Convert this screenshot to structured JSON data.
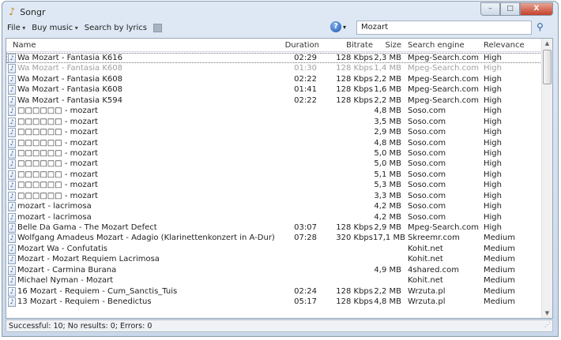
{
  "window": {
    "title": "Songr",
    "minimize": "–",
    "maximize": "□",
    "close": "X"
  },
  "toolbar": {
    "file": "File",
    "buy_music": "Buy music",
    "search_by_lyrics": "Search by lyrics"
  },
  "search": {
    "value": "Mozart"
  },
  "columns": {
    "name": "Name",
    "duration": "Duration",
    "bitrate": "Bitrate",
    "size": "Size",
    "engine": "Search engine",
    "relevance": "Relevance"
  },
  "rows": [
    {
      "name": "Wa Mozart - Fantasia K616",
      "duration": "02:29",
      "bitrate": "128 Kbps",
      "size": "2,3 MB",
      "engine": "Mpeg-Search.com",
      "relevance": "High",
      "state": "selected"
    },
    {
      "name": "Wa Mozart - Fantasia K608",
      "duration": "01:30",
      "bitrate": "128 Kbps",
      "size": "1,4 MB",
      "engine": "Mpeg-Search.com",
      "relevance": "High",
      "state": "dimmed"
    },
    {
      "name": "Wa Mozart - Fantasia K608",
      "duration": "02:22",
      "bitrate": "128 Kbps",
      "size": "2,2 MB",
      "engine": "Mpeg-Search.com",
      "relevance": "High"
    },
    {
      "name": "Wa Mozart - Fantasia K608",
      "duration": "01:41",
      "bitrate": "128 Kbps",
      "size": "1,6 MB",
      "engine": "Mpeg-Search.com",
      "relevance": "High"
    },
    {
      "name": "Wa Mozart - Fantasia K594",
      "duration": "02:22",
      "bitrate": "128 Kbps",
      "size": "2,2 MB",
      "engine": "Mpeg-Search.com",
      "relevance": "High"
    },
    {
      "name": "□□□□□□ - mozart",
      "duration": "",
      "bitrate": "",
      "size": "4,8 MB",
      "engine": "Soso.com",
      "relevance": "High"
    },
    {
      "name": "□□□□□□ - mozart",
      "duration": "",
      "bitrate": "",
      "size": "3,5 MB",
      "engine": "Soso.com",
      "relevance": "High"
    },
    {
      "name": "□□□□□□ - mozart",
      "duration": "",
      "bitrate": "",
      "size": "2,9 MB",
      "engine": "Soso.com",
      "relevance": "High"
    },
    {
      "name": "□□□□□□ - mozart",
      "duration": "",
      "bitrate": "",
      "size": "4,8 MB",
      "engine": "Soso.com",
      "relevance": "High"
    },
    {
      "name": "□□□□□□ - mozart",
      "duration": "",
      "bitrate": "",
      "size": "5,0 MB",
      "engine": "Soso.com",
      "relevance": "High"
    },
    {
      "name": "□□□□□□ - mozart",
      "duration": "",
      "bitrate": "",
      "size": "5,0 MB",
      "engine": "Soso.com",
      "relevance": "High"
    },
    {
      "name": "□□□□□□ - mozart",
      "duration": "",
      "bitrate": "",
      "size": "5,1 MB",
      "engine": "Soso.com",
      "relevance": "High"
    },
    {
      "name": "□□□□□□ - mozart",
      "duration": "",
      "bitrate": "",
      "size": "5,3 MB",
      "engine": "Soso.com",
      "relevance": "High"
    },
    {
      "name": "□□□□□□ - mozart",
      "duration": "",
      "bitrate": "",
      "size": "3,3 MB",
      "engine": "Soso.com",
      "relevance": "High"
    },
    {
      "name": "mozart - lacrimosa",
      "duration": "",
      "bitrate": "",
      "size": "4,2 MB",
      "engine": "Soso.com",
      "relevance": "High"
    },
    {
      "name": "mozart - lacrimosa",
      "duration": "",
      "bitrate": "",
      "size": "4,2 MB",
      "engine": "Soso.com",
      "relevance": "High"
    },
    {
      "name": "Belle Da Gama - The Mozart Defect",
      "duration": "03:07",
      "bitrate": "128 Kbps",
      "size": "2,9 MB",
      "engine": "Mpeg-Search.com",
      "relevance": "High"
    },
    {
      "name": "Wolfgang Amadeus Mozart - Adagio (Klarinettenkonzert in A-Dur)",
      "duration": "07:28",
      "bitrate": "320 Kbps",
      "size": "17,1 MB",
      "engine": "Skreemr.com",
      "relevance": "Medium"
    },
    {
      "name": "Mozart Wa - Confutatis",
      "duration": "",
      "bitrate": "",
      "size": "",
      "engine": "Kohit.net",
      "relevance": "Medium"
    },
    {
      "name": "Mozart - Mozart Requiem Lacrimosa",
      "duration": "",
      "bitrate": "",
      "size": "",
      "engine": "Kohit.net",
      "relevance": "Medium"
    },
    {
      "name": "Mozart - Carmina Burana",
      "duration": "",
      "bitrate": "",
      "size": "4,9 MB",
      "engine": "4shared.com",
      "relevance": "Medium"
    },
    {
      "name": "Michael Nyman - Mozart",
      "duration": "",
      "bitrate": "",
      "size": "",
      "engine": "Kohit.net",
      "relevance": "Medium"
    },
    {
      "name": "16 Mozart - Requiem - Cum_Sanctis_Tuis",
      "duration": "02:24",
      "bitrate": "128 Kbps",
      "size": "2,2 MB",
      "engine": "Wrzuta.pl",
      "relevance": "Medium"
    },
    {
      "name": "13 Mozart - Requiem - Benedictus",
      "duration": "05:17",
      "bitrate": "128 Kbps",
      "size": "4,8 MB",
      "engine": "Wrzuta.pl",
      "relevance": "Medium"
    }
  ],
  "status": "Successful: 10; No results: 0; Errors: 0"
}
